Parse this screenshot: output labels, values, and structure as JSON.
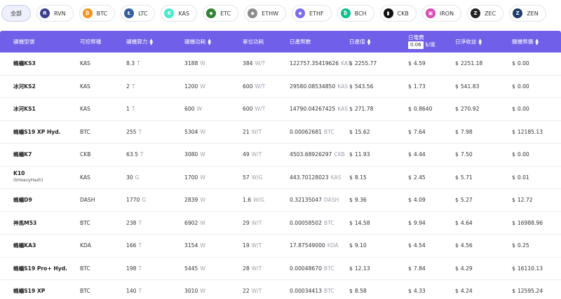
{
  "coins": {
    "all_label": "全部",
    "items": [
      {
        "label": "RVN",
        "icon": "rvn-icon",
        "color": "#3a3f8f",
        "glyph": "R"
      },
      {
        "label": "BTC",
        "icon": "btc-icon",
        "color": "#f7931a",
        "glyph": "₿"
      },
      {
        "label": "LTC",
        "icon": "ltc-icon",
        "color": "#345d9d",
        "glyph": "Ł"
      },
      {
        "label": "KAS",
        "icon": "kas-icon",
        "color": "#49eacb",
        "glyph": "K"
      },
      {
        "label": "ETC",
        "icon": "etc-icon",
        "color": "#328332",
        "glyph": "◆"
      },
      {
        "label": "ETHW",
        "icon": "ethw-icon",
        "color": "#8c8c8c",
        "glyph": "◆"
      },
      {
        "label": "ETHF",
        "icon": "ethf-icon",
        "color": "#7b6cf0",
        "glyph": "◆"
      },
      {
        "label": "BCH",
        "icon": "bch-icon",
        "color": "#0ac18e",
        "glyph": "₿"
      },
      {
        "label": "CKB",
        "icon": "ckb-icon",
        "color": "#111111",
        "glyph": "▮"
      },
      {
        "label": "IRON",
        "icon": "iron-icon",
        "color": "#d94ab5",
        "glyph": "▣"
      },
      {
        "label": "ZEC",
        "icon": "zec-icon",
        "color": "#222222",
        "glyph": "Z"
      },
      {
        "label": "ZEN",
        "icon": "zen-icon",
        "color": "#1c3d6e",
        "glyph": "Z"
      }
    ]
  },
  "table": {
    "headers": {
      "model": "礦機型號",
      "coin": "可挖幣種",
      "hashrate": "礦機算力",
      "power": "礦機功耗",
      "efficiency": "單位功耗",
      "daily_coin": "日產幣數",
      "daily_value": "日產值",
      "electricity": "日電費",
      "price_value": "0.06",
      "price_unit": "$/度",
      "net_profit": "日淨收益",
      "shutdown_price": "關機幣價"
    },
    "rows": [
      {
        "model": "螞蟻KS3",
        "sub": "",
        "coin": "KAS",
        "hash": "8.3",
        "hash_unit": "T",
        "power": "3188",
        "power_unit": "W",
        "eff": "384",
        "eff_unit": "W/T",
        "daily_coin": "122757.35419626",
        "daily_coin_unit": "KAS",
        "value": "2255.77",
        "elec": "4.59",
        "net": "2251.18",
        "shutdown": "0.00"
      },
      {
        "model": "冰河KS2",
        "sub": "",
        "coin": "KAS",
        "hash": "2",
        "hash_unit": "T",
        "power": "1200",
        "power_unit": "W",
        "eff": "600",
        "eff_unit": "W/T",
        "daily_coin": "29580.08534850",
        "daily_coin_unit": "KAS",
        "value": "543.56",
        "elec": "1.73",
        "net": "541.83",
        "shutdown": "0.00"
      },
      {
        "model": "冰河KS1",
        "sub": "",
        "coin": "KAS",
        "hash": "1",
        "hash_unit": "T",
        "power": "600",
        "power_unit": "W",
        "eff": "600",
        "eff_unit": "W/T",
        "daily_coin": "14790.04267425",
        "daily_coin_unit": "KAS",
        "value": "271.78",
        "elec": "0.8640",
        "net": "270.92",
        "shutdown": "0.00"
      },
      {
        "model": "螞蟻S19 XP Hyd.",
        "sub": "",
        "coin": "BTC",
        "hash": "255",
        "hash_unit": "T",
        "power": "5304",
        "power_unit": "W",
        "eff": "21",
        "eff_unit": "W/T",
        "daily_coin": "0.00062681",
        "daily_coin_unit": "BTC",
        "value": "15.62",
        "elec": "7.64",
        "net": "7.98",
        "shutdown": "12185.13"
      },
      {
        "model": "螞蟻K7",
        "sub": "",
        "coin": "CKB",
        "hash": "63.5",
        "hash_unit": "T",
        "power": "3080",
        "power_unit": "W",
        "eff": "49",
        "eff_unit": "W/T",
        "daily_coin": "4503.68926297",
        "daily_coin_unit": "CKB",
        "value": "11.93",
        "elec": "4.44",
        "net": "7.50",
        "shutdown": "0.00"
      },
      {
        "model": "K10",
        "sub": "(kHeavyHash)",
        "coin": "KAS",
        "hash": "30",
        "hash_unit": "G",
        "power": "1700",
        "power_unit": "W",
        "eff": "57",
        "eff_unit": "W/G",
        "daily_coin": "443.70128023",
        "daily_coin_unit": "KAS",
        "value": "8.15",
        "elec": "2.45",
        "net": "5.71",
        "shutdown": "0.01"
      },
      {
        "model": "螞蟻D9",
        "sub": "",
        "coin": "DASH",
        "hash": "1770",
        "hash_unit": "G",
        "power": "2839",
        "power_unit": "W",
        "eff": "1.6",
        "eff_unit": "W/G",
        "daily_coin": "0.32135047",
        "daily_coin_unit": "DASH",
        "value": "9.36",
        "elec": "4.09",
        "net": "5.27",
        "shutdown": "12.72"
      },
      {
        "model": "神馬M53",
        "sub": "",
        "coin": "BTC",
        "hash": "238",
        "hash_unit": "T",
        "power": "6902",
        "power_unit": "W",
        "eff": "29",
        "eff_unit": "W/T",
        "daily_coin": "0.00058502",
        "daily_coin_unit": "BTC",
        "value": "14.58",
        "elec": "9.94",
        "net": "4.64",
        "shutdown": "16988.96"
      },
      {
        "model": "螞蟻KA3",
        "sub": "",
        "coin": "KDA",
        "hash": "166",
        "hash_unit": "T",
        "power": "3154",
        "power_unit": "W",
        "eff": "19",
        "eff_unit": "W/T",
        "daily_coin": "17.87549000",
        "daily_coin_unit": "KDA",
        "value": "9.10",
        "elec": "4.54",
        "net": "4.56",
        "shutdown": "0.25"
      },
      {
        "model": "螞蟻S19 Pro+ Hyd.",
        "sub": "",
        "coin": "BTC",
        "hash": "198",
        "hash_unit": "T",
        "power": "5445",
        "power_unit": "W",
        "eff": "28",
        "eff_unit": "W/T",
        "daily_coin": "0.00048670",
        "daily_coin_unit": "BTC",
        "value": "12.13",
        "elec": "7.84",
        "net": "4.29",
        "shutdown": "16110.13"
      },
      {
        "model": "螞蟻S19 XP",
        "sub": "",
        "coin": "BTC",
        "hash": "140",
        "hash_unit": "T",
        "power": "3010",
        "power_unit": "W",
        "eff": "22",
        "eff_unit": "W/T",
        "daily_coin": "0.00034413",
        "daily_coin_unit": "BTC",
        "value": "8.58",
        "elec": "4.33",
        "net": "4.24",
        "shutdown": "12595.24"
      }
    ]
  }
}
